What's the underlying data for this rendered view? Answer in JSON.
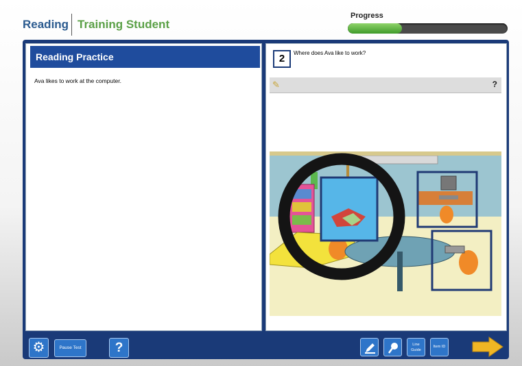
{
  "header": {
    "subject": "Reading",
    "student": "Training Student",
    "progress_label": "Progress",
    "progress_fraction": 0.34
  },
  "passage": {
    "title": "Reading Practice",
    "text": "Ava likes to work at the computer."
  },
  "question": {
    "number": "2",
    "text": "Where does Ava like to work?",
    "help_label": "?",
    "illustration": "classroom-scene"
  },
  "toolbar": {
    "pause_label": "Pause Test",
    "help_label": "?",
    "line_guide_label": "Line Guide",
    "item_label": "Item ID"
  },
  "icons": {
    "settings": "gear-icon",
    "pencil": "pencil-icon",
    "highlighter": "highlighter-icon",
    "magnifier": "magnifier-icon",
    "next": "next-arrow-icon"
  },
  "colors": {
    "subject": "#2a5a8f",
    "student": "#5aa046",
    "frame": "#1a3a78",
    "header": "#1f4c9d",
    "button": "#2e75c9",
    "next": "#f0b624"
  }
}
